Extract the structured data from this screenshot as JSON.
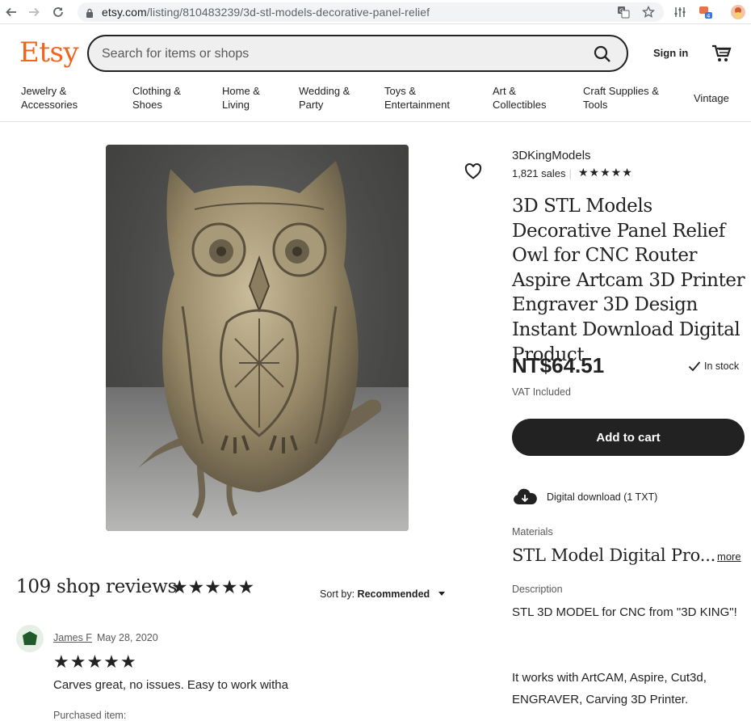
{
  "browser": {
    "url_host": "etsy.com",
    "url_path": "/listing/810483239/3d-stl-models-decorative-panel-relief",
    "extension_badge": "4"
  },
  "header": {
    "logo": "Etsy",
    "search_placeholder": "Search for items or shops",
    "signin_label": "Sign in",
    "brand_color": "#f1641e"
  },
  "categories": [
    {
      "line1": "Jewelry &",
      "line2": "Accessories"
    },
    {
      "line1": "Clothing &",
      "line2": "Shoes"
    },
    {
      "line1": "Home &",
      "line2": "Living"
    },
    {
      "line1": "Wedding &",
      "line2": "Party"
    },
    {
      "line1": "Toys &",
      "line2": "Entertainment"
    },
    {
      "line1": "Art &",
      "line2": "Collectibles"
    },
    {
      "line1": "Craft Supplies &",
      "line2": "Tools"
    },
    {
      "line1": "Vintage",
      "line2": ""
    }
  ],
  "listing": {
    "shop_name": "3DKingModels",
    "sales": "1,821 sales",
    "rating_stars": "★★★★★",
    "title": "3D STL Models Decorative Panel Relief Owl for CNC Router Aspire Artcam 3D Printer Engraver 3D Design Instant Download Digital Product",
    "price": "NT$64.51",
    "stock": "In stock",
    "vat": "VAT Included",
    "add_to_cart": "Add to cart",
    "download": "Digital download (1 TXT)",
    "materials_label": "Materials",
    "materials_value": "STL Model Digital Pro...",
    "more_label": "more",
    "description_label": "Description",
    "description_p1": "STL 3D MODEL for CNC from \"3D KING\"!",
    "description_p2": "It works with ArtCAM, Aspire, Cut3d, ENGRAVER, Carving 3D Printer."
  },
  "reviews": {
    "title": "109 shop reviews",
    "stars": "★★★★★",
    "sort_prefix": "Sort by: ",
    "sort_value": "Recommended",
    "items": [
      {
        "name": "James F",
        "date": "May 28, 2020",
        "stars": "★★★★★",
        "text": "Carves great, no issues. Easy to work witha",
        "purchased_label": "Purchased item:"
      }
    ]
  }
}
